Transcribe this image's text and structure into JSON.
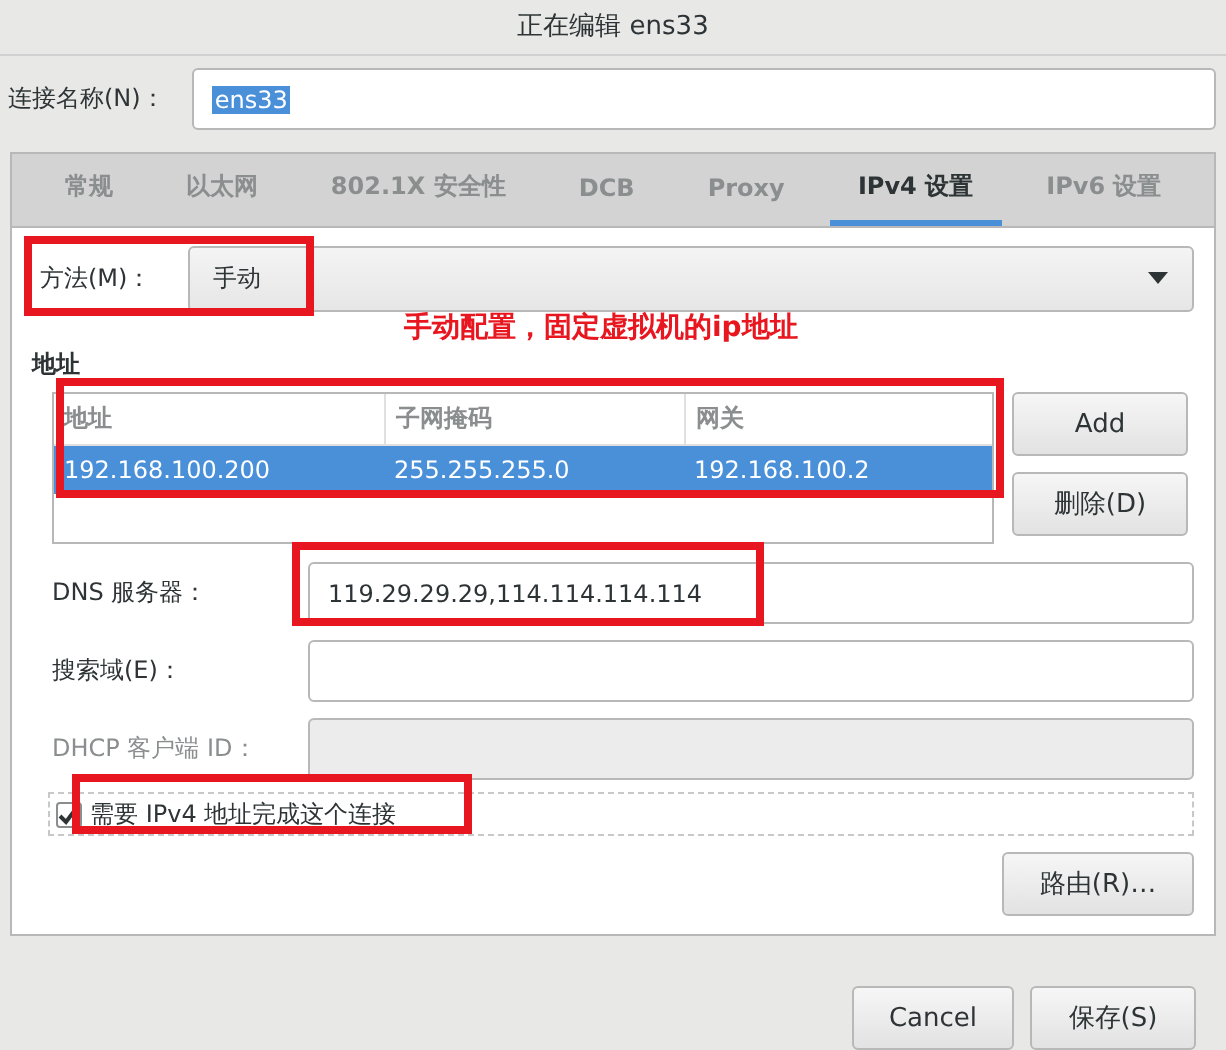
{
  "window": {
    "title": "正在编辑 ens33"
  },
  "connection_name": {
    "label": "连接名称(N)：",
    "value": "ens33"
  },
  "tabs": [
    {
      "label": "常规",
      "selected": false
    },
    {
      "label": "以太网",
      "selected": false
    },
    {
      "label": "802.1X 安全性",
      "selected": false
    },
    {
      "label": "DCB",
      "selected": false
    },
    {
      "label": "Proxy",
      "selected": false
    },
    {
      "label": "IPv4 设置",
      "selected": true
    },
    {
      "label": "IPv6 设置",
      "selected": false
    }
  ],
  "method": {
    "label": "方法(M)：",
    "value": "手动"
  },
  "annotation": "手动配置，固定虚拟机的ip地址",
  "addresses": {
    "title": "地址",
    "columns": [
      "地址",
      "子网掩码",
      "网关"
    ],
    "rows": [
      {
        "cells": [
          "192.168.100.200",
          "255.255.255.0",
          "192.168.100.2"
        ],
        "selected": true
      }
    ],
    "buttons": [
      "Add",
      "删除(D)"
    ]
  },
  "fields": [
    {
      "label": "DNS 服务器：",
      "value": "119.29.29.29,114.114.114.114",
      "disabled": false
    },
    {
      "label": "搜索域(E)：",
      "disabled": false
    },
    {
      "label": "DHCP 客户端 ID：",
      "disabled": true
    }
  ],
  "require_ipv4": {
    "label": "需要 IPv4 地址完成这个连接",
    "checked": true
  },
  "routes_button": "路由(R)…",
  "buttons": [
    "Cancel",
    "保存(S)"
  ]
}
